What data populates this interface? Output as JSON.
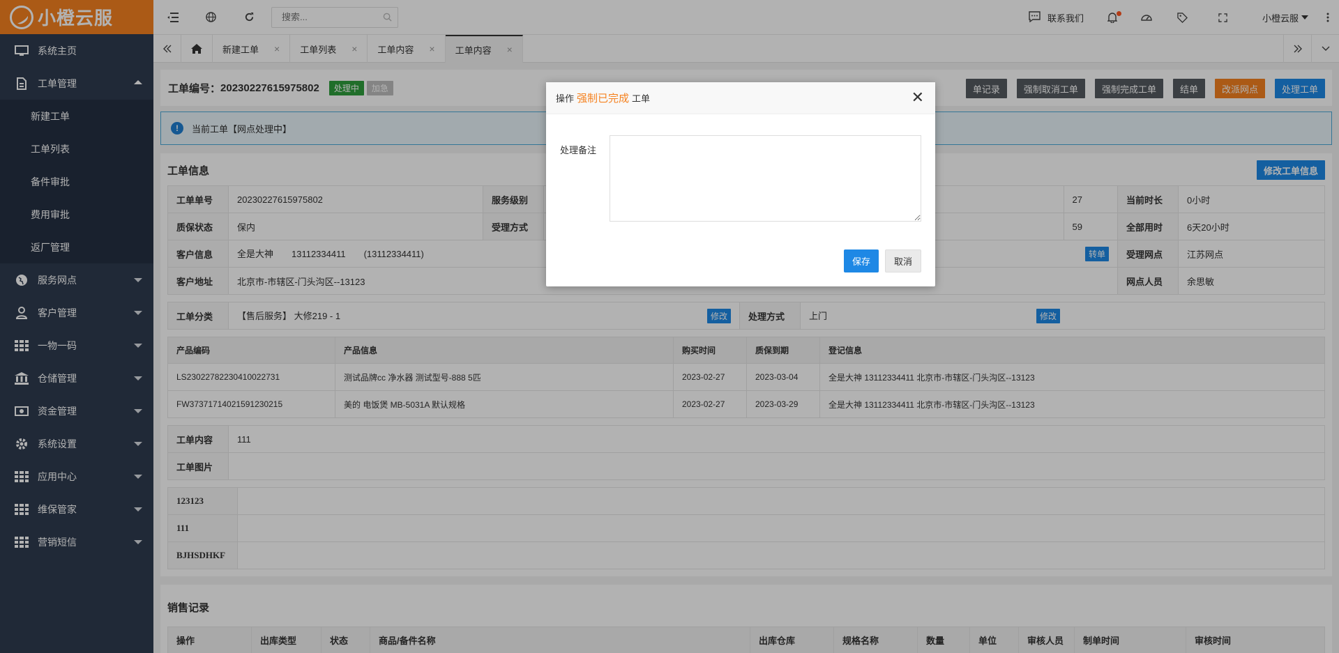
{
  "brand": {
    "name": "小橙云服",
    "color": "#f58220"
  },
  "sidebar": {
    "items": [
      {
        "label": "系统主页",
        "icon": "monitor-icon"
      },
      {
        "label": "工单管理",
        "icon": "document-icon",
        "expanded": true,
        "children": [
          "新建工单",
          "工单列表",
          "备件审批",
          "费用审批",
          "返厂管理"
        ]
      },
      {
        "label": "服务网点",
        "icon": "globe-icon"
      },
      {
        "label": "客户管理",
        "icon": "user-icon"
      },
      {
        "label": "一物一码",
        "icon": "grid-icon"
      },
      {
        "label": "仓储管理",
        "icon": "bank-icon"
      },
      {
        "label": "资金管理",
        "icon": "money-icon"
      },
      {
        "label": "系统设置",
        "icon": "gear-icon"
      },
      {
        "label": "应用中心",
        "icon": "grid-icon"
      },
      {
        "label": "维保管家",
        "icon": "grid-icon"
      },
      {
        "label": "营销短信",
        "icon": "grid-icon"
      }
    ]
  },
  "topbar": {
    "search_placeholder": "搜索...",
    "contact_label": "联系我们",
    "user_name": "小橙云服"
  },
  "tabs": [
    {
      "label": "新建工单"
    },
    {
      "label": "工单列表"
    },
    {
      "label": "工单内容"
    },
    {
      "label": "工单内容",
      "active": true
    }
  ],
  "header": {
    "title_prefix": "工单编号：",
    "order_no": "20230227615975802",
    "status_badge": "处理中",
    "urgent_badge": "加急",
    "buttons": [
      {
        "label": "单记录",
        "color": "#555b61"
      },
      {
        "label": "强制取消工单",
        "color": "#555b61"
      },
      {
        "label": "强制完成工单",
        "color": "#555b61"
      },
      {
        "label": "结单",
        "color": "#555b61"
      },
      {
        "label": "改派网点",
        "color": "#f58220"
      },
      {
        "label": "处理工单",
        "color": "#1e88e5"
      }
    ]
  },
  "alert": {
    "text": "当前工单【网点处理中】"
  },
  "order_info": {
    "title": "工单信息",
    "edit_button": "修改工单信息",
    "rows": [
      [
        "工单单号",
        "20230227615975802",
        "服务级别",
        "",
        "",
        "27",
        "当前时长",
        "0小时"
      ],
      [
        "质保状态",
        "保内",
        "受理方式",
        "",
        "",
        "59",
        "全部用时",
        "6天20小时"
      ],
      [
        "客户信息",
        "全是大神　　13112334411　　(13112334411)",
        "",
        "",
        "",
        "",
        "受理网点",
        "江苏网点"
      ],
      [
        "客户地址",
        "北京市-市辖区-门头沟区--13123",
        "",
        "",
        "",
        "",
        "网点人员",
        "余思敏"
      ]
    ],
    "transfer_button": "转单",
    "category_label": "工单分类",
    "category_value": "【售后服务】 大修219 - 1",
    "method_label": "处理方式",
    "method_value": "上门",
    "modify_label": "修改"
  },
  "products": {
    "headers": [
      "产品编码",
      "产品信息",
      "购买时间",
      "质保到期",
      "登记信息"
    ],
    "rows": [
      [
        "LS23022782230410022731",
        "测试品牌cc 净水器 测试型号-888 5匹",
        "2023-02-27",
        "2023-03-04",
        "全是大神 13112334411 北京市-市辖区-门头沟区--13123"
      ],
      [
        "FW37371714021591230215",
        "美的 电饭煲 MB-5031A 默认规格",
        "2023-02-27",
        "2023-03-29",
        "全是大神 13112334411 北京市-市辖区-门头沟区--13123"
      ]
    ]
  },
  "content": {
    "content_label": "工单内容",
    "content_value": "111",
    "image_label": "工单图片"
  },
  "extra_fields": [
    "123123",
    "111",
    "BJHSDHKF"
  ],
  "sales": {
    "title": "销售记录",
    "headers": [
      "操作",
      "出库类型",
      "状态",
      "商品/备件名称",
      "出库仓库",
      "规格名称",
      "数量",
      "单位",
      "审核人员",
      "制单时间",
      "审核时间"
    ]
  },
  "dialog": {
    "prefix": "操作",
    "action": "强制已完成",
    "suffix": "工单",
    "field_label": "处理备注",
    "field_value": "",
    "save_label": "保存",
    "cancel_label": "取消"
  }
}
